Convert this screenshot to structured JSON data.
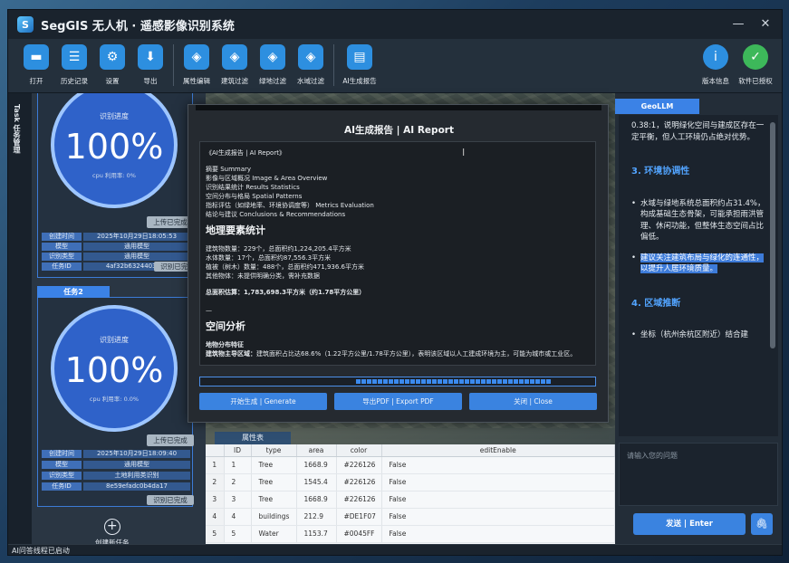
{
  "app": {
    "logo_glyph": "S",
    "title": "SegGIS 无人机 · 遥感影像识别系统",
    "minimize": "—",
    "close": "✕"
  },
  "toolbar": [
    {
      "icon": "folder-icon",
      "glyph": "▬",
      "label": "打开",
      "color": "#2d8fe0"
    },
    {
      "icon": "history-icon",
      "glyph": "☰",
      "label": "历史记录",
      "color": "#2d8fe0"
    },
    {
      "icon": "gear-icon",
      "glyph": "⚙",
      "label": "设置",
      "color": "#2d8fe0"
    },
    {
      "icon": "export-icon",
      "glyph": "⬇",
      "label": "导出",
      "color": "#2d8fe0"
    },
    {
      "icon": "attribute-edit-icon",
      "glyph": "◈",
      "label": "属性编辑",
      "color": "#3a9ae8"
    },
    {
      "icon": "building-filter-icon",
      "glyph": "◈",
      "label": "建筑过滤",
      "color": "#3a9ae8"
    },
    {
      "icon": "green-filter-icon",
      "glyph": "◈",
      "label": "绿地过滤",
      "color": "#3a9ae8"
    },
    {
      "icon": "water-filter-icon",
      "glyph": "◈",
      "label": "水域过滤",
      "color": "#3a9ae8"
    },
    {
      "icon": "ai-report-icon",
      "glyph": "▤",
      "label": "AI生成报告",
      "color": "#2d8fe0"
    }
  ],
  "toolbar_right": [
    {
      "icon": "info-icon",
      "glyph": "i",
      "label": "版本信息",
      "color": "#2d8fe0"
    },
    {
      "icon": "license-icon",
      "glyph": "✓",
      "label": "软件已授权",
      "color": "#3db85a"
    }
  ],
  "left_tab": "Task 任务管理",
  "tasks": [
    {
      "header": "",
      "progress_label": "识别进度",
      "percent": "100%",
      "cpu": "cpu 利用率: 0%",
      "upload": "上传已完成",
      "fields": [
        {
          "k": "创建时间",
          "v": "2025年10月29日18:05:53"
        },
        {
          "k": "模型",
          "v": "通用模型"
        },
        {
          "k": "识别类型",
          "v": "通用模型"
        },
        {
          "k": "任务ID",
          "v": "4af32b6324403ca6"
        }
      ],
      "status": "识别已完成"
    },
    {
      "header": "任务2",
      "progress_label": "识别进度",
      "percent": "100%",
      "cpu": "cpu 利用率: 0.0%",
      "upload": "上传已完成",
      "fields": [
        {
          "k": "创建时间",
          "v": "2025年10月29日18:09:40"
        },
        {
          "k": "模型",
          "v": "通用模型"
        },
        {
          "k": "识别类型",
          "v": "土地利用类识别"
        },
        {
          "k": "任务ID",
          "v": "8e59efadc0b4da17"
        }
      ],
      "status": "识别已完成"
    }
  ],
  "new_task": {
    "glyph": "+",
    "label": "创建新任务"
  },
  "attr_table": {
    "tab": "属性表",
    "columns": [
      "",
      "ID",
      "type",
      "area",
      "color",
      "editEnable"
    ],
    "rows": [
      [
        "1",
        "1",
        "Tree",
        "1668.9",
        "#226126",
        "False"
      ],
      [
        "2",
        "2",
        "Tree",
        "1545.4",
        "#226126",
        "False"
      ],
      [
        "3",
        "3",
        "Tree",
        "1668.9",
        "#226126",
        "False"
      ],
      [
        "4",
        "4",
        "buildings",
        "212.9",
        "#DE1F07",
        "False"
      ],
      [
        "5",
        "5",
        "Water",
        "1153.7",
        "#0045FF",
        "False"
      ]
    ]
  },
  "dialog": {
    "title": "AI生成报告 | AI Report",
    "report": {
      "doc_title": "《AI生成报告 | AI Report》",
      "toc": [
        "摘要 Summary",
        "影像与区域概况 Image & Area Overview",
        "识别结果统计 Results Statistics",
        "空间分布与格局 Spatial Patterns",
        "指标评估（如绿地率、环境协调度等） Metrics Evaluation",
        "结论与建议 Conclusions & Recommendations"
      ],
      "h1": "地理要素统计",
      "stats": [
        "建筑物数量：229个，总面积约1,224,205.4平方米",
        "水体数量：17个，总面积约87,556.3平方米",
        "植被（树木）数量：488个，总面积约471,936.6平方米",
        "其他物体：未提供明确分类，需补充数据"
      ],
      "total": "总面积估算：1,783,698.3平方米（约1.78平方公里）",
      "hr": "—",
      "h2": "空间分析",
      "sub": "地物分布特征",
      "para_b": "建筑物主导区域：",
      "para": "建筑面积占比达68.6%（1.22平方公里/1.78平方公里），表明该区域以人工建成环境为主，可能为城市或工业区。"
    },
    "progress": 0.55,
    "buttons": [
      "开始生成 | Generate",
      "导出PDF | Export PDF",
      "关闭 | Close"
    ]
  },
  "geollm": {
    "tab": "GeoLLM",
    "intro": "0.38:1，说明绿化空间与建成区存在一定平衡，但人工环境仍占绝对优势。",
    "h_env": "3. 环境协调性",
    "env_items": [
      "水域与绿地系统总面积约占31.4%，构成基础生态骨架，可能承担雨洪管理、休闲功能，但整体生态空间占比偏低。"
    ],
    "env_highlight": "建议关注建筑布局与绿化的连通性，以提升人居环境质量。",
    "h_region": "4. 区域推断",
    "region_items": [
      "坐标（杭州余杭区附近）结合建"
    ],
    "input_placeholder": "请输入您的问题",
    "send": "发送 | Enter",
    "attach_glyph": "🖇"
  },
  "status_bar": "AI问答线程已启动"
}
